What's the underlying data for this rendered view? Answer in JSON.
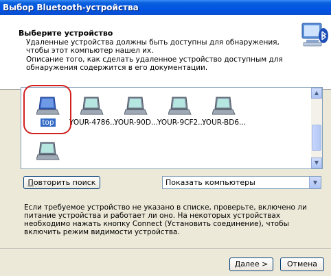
{
  "window": {
    "title": "Выбор Bluetooth-устройства"
  },
  "header": {
    "title": "Выберите устройство",
    "line1": "Удаленные устройства должны быть доступны для обнаружения, чтобы этот компьютер нашел их.",
    "line2": "Описание того, как сделать удаленное устройство доступным для обнаружения содержится в его документации."
  },
  "devices": [
    {
      "label": "top",
      "selected": true,
      "icon": "laptop-icon"
    },
    {
      "label": "YOUR-4786...",
      "selected": false,
      "icon": "laptop-icon"
    },
    {
      "label": "YOUR-90D...",
      "selected": false,
      "icon": "laptop-icon"
    },
    {
      "label": "YOUR-9CF2...",
      "selected": false,
      "icon": "laptop-icon"
    },
    {
      "label": "YOUR-BD6...",
      "selected": false,
      "icon": "laptop-icon"
    },
    {
      "label": "",
      "selected": false,
      "icon": "laptop-icon"
    }
  ],
  "controls": {
    "repeat_search_u": "П",
    "repeat_search_rest": "овторить поиск",
    "filter_value": "Показать компьютеры"
  },
  "info_text": "Если требуемое устройство не указано в списке, проверьте, включено ли питание устройства и работает ли оно. На некоторых устройствах необходимо нажать кнопку Connect (Установить соединение), чтобы включить режим видимости устройства.",
  "footer": {
    "next_u": "Д",
    "next_rest": "алее >",
    "cancel": "Отмена"
  },
  "colors": {
    "titlebar": "#0054e3",
    "selection": "#316ac5",
    "highlight_ring": "#d21f1f"
  }
}
